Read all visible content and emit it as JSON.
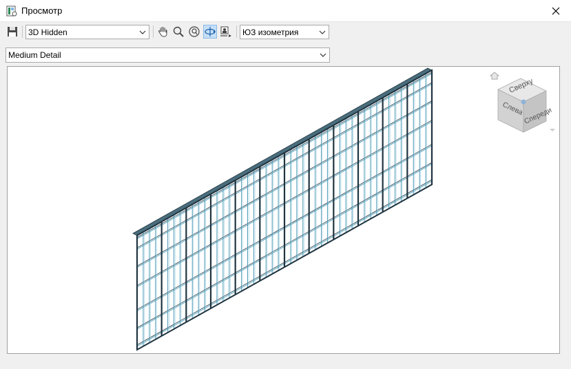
{
  "window": {
    "title": "Просмотр"
  },
  "toolbar": {
    "visual_style": "3D Hidden",
    "view_orientation": "ЮЗ изометрия",
    "detail_level": "Medium Detail"
  },
  "viewcube": {
    "top_label": "Сверху",
    "left_label": "Слева",
    "front_label": "Спереди"
  },
  "icons": [
    "app-icon",
    "close-icon",
    "save-icon",
    "pan-icon",
    "zoom-icon",
    "zoom-region-icon",
    "orbit-icon",
    "camera-icon",
    "chevron-down-icon",
    "home-icon"
  ]
}
